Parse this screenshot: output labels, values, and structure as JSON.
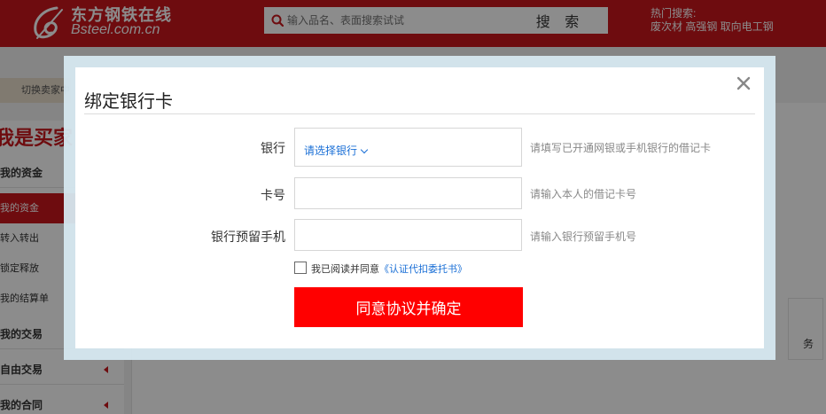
{
  "header": {
    "logo_cn": "东方钢铁在线",
    "logo_en": "Bsteel.com.cn",
    "search_placeholder": "输入品名、表面搜索试试",
    "search_button": "搜 索",
    "hot_title": "热门搜索:",
    "hot_links": "废次材 高强钢 取向电工钢"
  },
  "background": {
    "switch_button": "切换卖家中",
    "role_title": "我是买家",
    "sidebar": [
      {
        "label": "我的资金",
        "kind": "group"
      },
      {
        "label": "我的资金",
        "kind": "active"
      },
      {
        "label": "转入转出",
        "kind": "sub"
      },
      {
        "label": "锁定释放",
        "kind": "sub"
      },
      {
        "label": "我的结算单",
        "kind": "sub"
      },
      {
        "label": "我的交易",
        "kind": "group"
      },
      {
        "label": "自由交易",
        "kind": "group"
      },
      {
        "label": "我的合同",
        "kind": "group"
      }
    ],
    "panel_fragment": "务"
  },
  "modal": {
    "title": "绑定银行卡",
    "fields": {
      "bank": {
        "label": "银行",
        "select_value": "请选择银行",
        "hint": "请填写已开通网银或手机银行的借记卡"
      },
      "card": {
        "label": "卡号",
        "value": "",
        "hint": "请输入本人的借记卡号"
      },
      "phone": {
        "label": "银行预留手机",
        "value": "",
        "hint": "请输入银行预留手机号"
      }
    },
    "agreement": {
      "prefix": "我已阅读并同意",
      "link": "《认证代扣委托书》",
      "checked": false
    },
    "confirm_button": "同意协议并确定"
  },
  "colors": {
    "brand_red": "#c8161d",
    "button_red": "#ff0000",
    "link_blue": "#1a6fd6"
  },
  "icons": [
    "logo-mark-icon",
    "search-icon",
    "close-icon",
    "chevron-down-icon",
    "caret-left-icon"
  ]
}
